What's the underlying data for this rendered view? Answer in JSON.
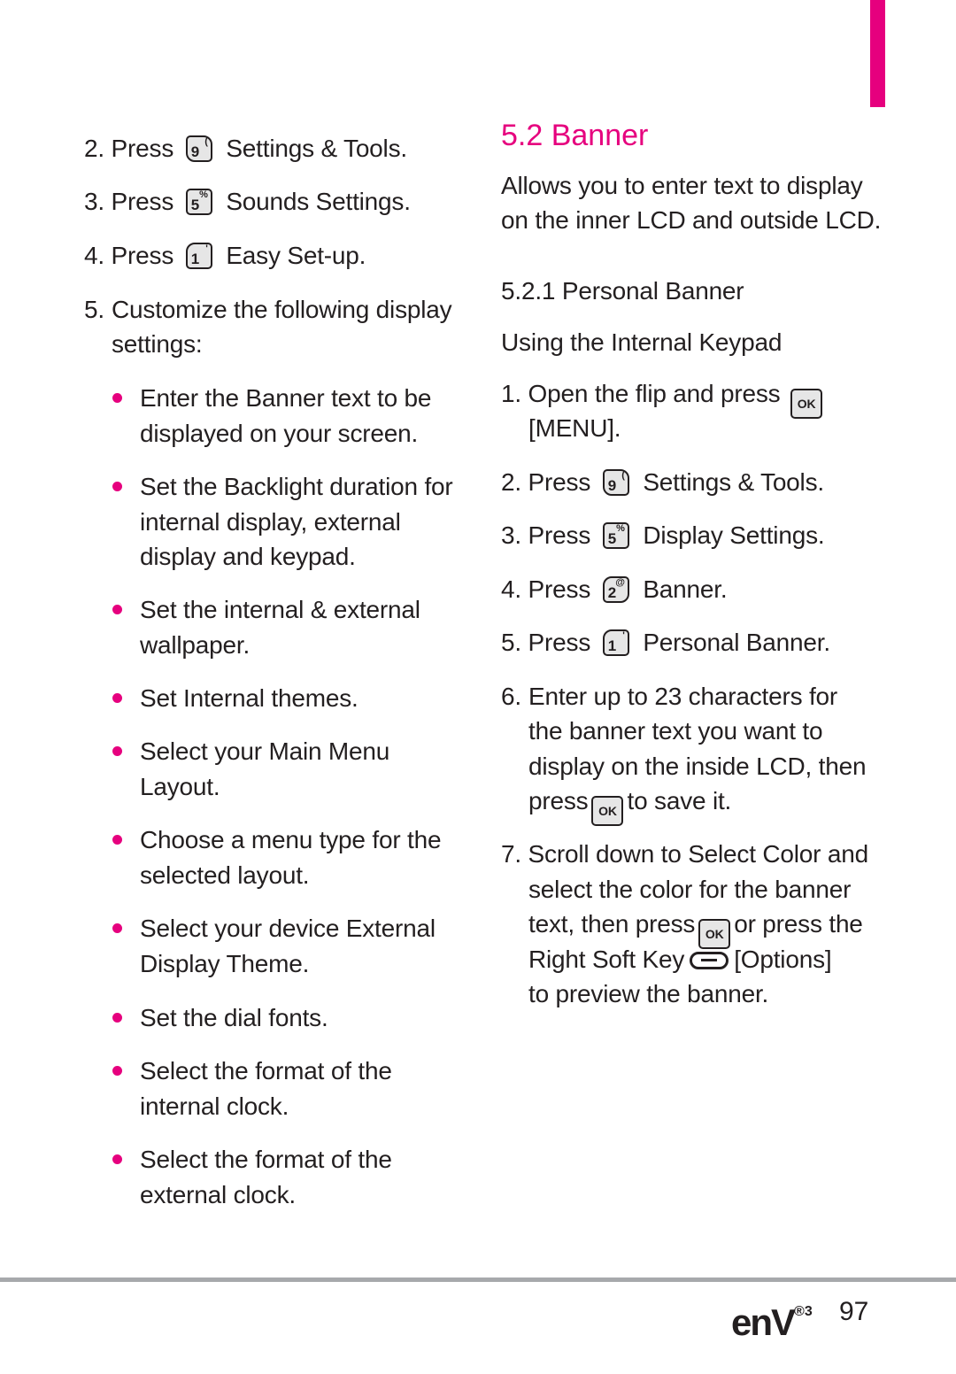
{
  "accent_color": "#e6007e",
  "left": {
    "steps": [
      {
        "num": "2.",
        "verb": "Press",
        "key": {
          "digit": "9",
          "sup": "(",
          "icon": "key-9-icon"
        },
        "label": "Settings & Tools."
      },
      {
        "num": "3.",
        "verb": "Press",
        "key": {
          "digit": "5",
          "sup": "%",
          "icon": "key-5-icon"
        },
        "label": "Sounds Settings."
      },
      {
        "num": "4.",
        "verb": "Press",
        "key": {
          "digit": "1",
          "sup": "'",
          "icon": "key-1-icon"
        },
        "label": "Easy Set-up."
      }
    ],
    "step5": {
      "num": "5.",
      "lines": [
        "Customize the following display",
        "settings:"
      ]
    },
    "bullets": [
      [
        "Enter the Banner text to be",
        "displayed on your screen."
      ],
      [
        "Set the Backlight duration for",
        "internal display, external",
        "display and keypad."
      ],
      [
        "Set the internal & external",
        "wallpaper."
      ],
      [
        "Set Internal themes."
      ],
      [
        "Select your Main Menu",
        "Layout."
      ],
      [
        "Choose a menu type for the",
        "selected layout."
      ],
      [
        "Select your device External",
        "Display Theme."
      ],
      [
        "Set the dial fonts."
      ],
      [
        "Select the format of the",
        "internal clock."
      ],
      [
        "Select the format of the",
        "external clock."
      ]
    ]
  },
  "right": {
    "title": "5.2 Banner",
    "intro": [
      "Allows you to enter text to display",
      "on the inner LCD and outside LCD."
    ],
    "subheading": "5.2.1 Personal Banner",
    "subsubheading": "Using the Internal Keypad",
    "step1": {
      "num": "1.",
      "text": "Open the flip and press",
      "ok_label": "OK",
      "line2": "[MENU]."
    },
    "steps": [
      {
        "num": "2.",
        "verb": "Press",
        "key": {
          "digit": "9",
          "sup": "(",
          "icon": "key-9-icon"
        },
        "label": "Settings & Tools."
      },
      {
        "num": "3.",
        "verb": "Press",
        "key": {
          "digit": "5",
          "sup": "%",
          "icon": "key-5-icon"
        },
        "label": "Display Settings."
      },
      {
        "num": "4.",
        "verb": "Press",
        "key": {
          "digit": "2",
          "sup": "@",
          "icon": "key-2-icon"
        },
        "label": "Banner."
      },
      {
        "num": "5.",
        "verb": "Press",
        "key": {
          "digit": "1",
          "sup": "'",
          "icon": "key-1-icon"
        },
        "label": "Personal Banner."
      }
    ],
    "step6": {
      "num": "6.",
      "lines": [
        "Enter up to 23 characters for",
        "the  banner text you want to",
        "display on the inside LCD, then"
      ],
      "last_pre": "press",
      "ok_label": "OK",
      "last_post": "to save it."
    },
    "step7": {
      "num": "7.",
      "line1": "Scroll down to Select Color and",
      "line2": "select the color for the banner",
      "line3_pre": "text, then press",
      "ok_label": "OK",
      "line3_post": "or press the",
      "line4_pre": "Right Soft Key",
      "line4_post": "[Options]",
      "line5": "to preview the banner."
    }
  },
  "footer": {
    "logo_text": "enV",
    "logo_sup": "®3",
    "page_number": "97"
  }
}
